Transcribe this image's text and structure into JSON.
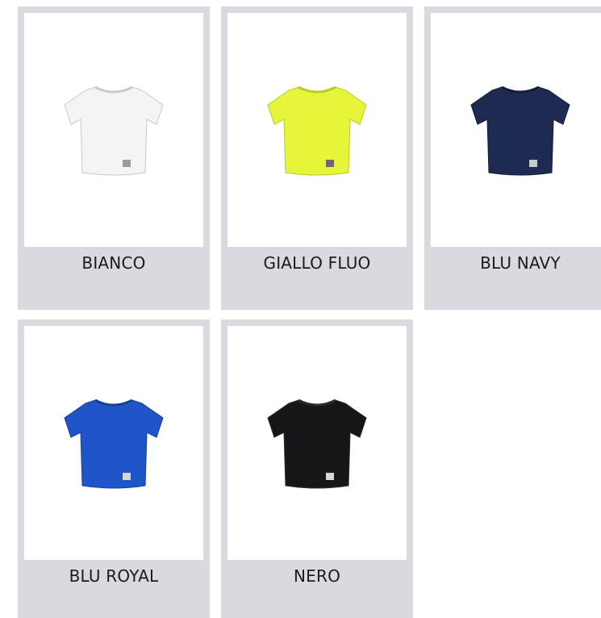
{
  "swatches": [
    {
      "label": "BIANCO",
      "color": "#f4f4f4",
      "trim": "#c9c9c9",
      "tag": "#9a9a9a"
    },
    {
      "label": "GIALLO FLUO",
      "color": "#e6f53a",
      "trim": "#b9c92a",
      "tag": "#6a6a6a"
    },
    {
      "label": "BLU NAVY",
      "color": "#1f2a52",
      "trim": "#151d3c",
      "tag": "#c9c9c9"
    },
    {
      "label": "BLU ROYAL",
      "color": "#1f55c8",
      "trim": "#163f98",
      "tag": "#d7d7d7"
    },
    {
      "label": "NERO",
      "color": "#15161a",
      "trim": "#2a2b30",
      "tag": "#d7d7d7"
    }
  ]
}
